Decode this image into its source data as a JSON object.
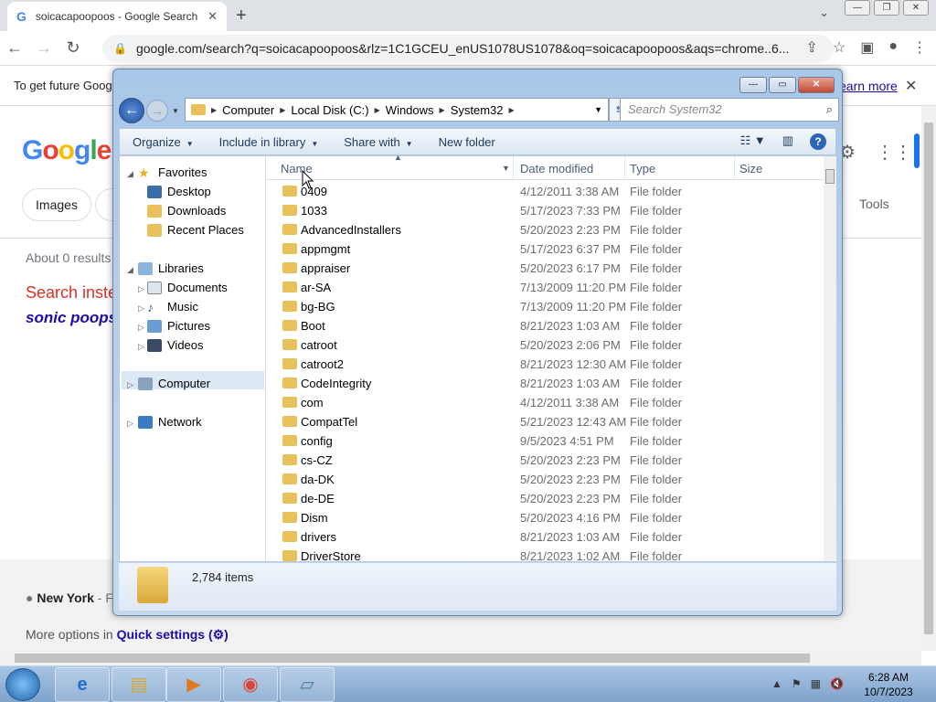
{
  "browser": {
    "tab_title": "soicacapoopoos - Google Search",
    "tab_close": "✕",
    "new_tab": "+",
    "url": "google.com/search?q=soicacapoopoos&rlz=1C1GCEU_enUS1078US1078&oq=soicacapoopoos&aqs=chrome..6...",
    "infobar_text": "To get future Goog",
    "infobar_link": "earn more",
    "infobar_close": "✕"
  },
  "google": {
    "logo": "Google",
    "pill_images": "Images",
    "tools": "Tools",
    "results_count": "About 0 results",
    "search_instead": "Search inste",
    "suggestion": "sonic poops",
    "location_city": "New York",
    "location_rest": " - Fi",
    "more_options_prefix": "More options in ",
    "more_options_link": "Quick settings (⚙)"
  },
  "explorer": {
    "breadcrumb": [
      "Computer",
      "Local Disk (C:)",
      "Windows",
      "System32"
    ],
    "search_placeholder": "Search System32",
    "commands": [
      "Organize",
      "Include in library",
      "Share with",
      "New folder"
    ],
    "nav": {
      "favorites": "Favorites",
      "desktop": "Desktop",
      "downloads": "Downloads",
      "recent": "Recent Places",
      "libraries": "Libraries",
      "documents": "Documents",
      "music": "Music",
      "pictures": "Pictures",
      "videos": "Videos",
      "computer": "Computer",
      "network": "Network"
    },
    "columns": {
      "name": "Name",
      "date": "Date modified",
      "type": "Type",
      "size": "Size"
    },
    "files": [
      {
        "name": "0409",
        "date": "4/12/2011 3:38 AM",
        "type": "File folder"
      },
      {
        "name": "1033",
        "date": "5/17/2023 7:33 PM",
        "type": "File folder"
      },
      {
        "name": "AdvancedInstallers",
        "date": "5/20/2023 2:23 PM",
        "type": "File folder"
      },
      {
        "name": "appmgmt",
        "date": "5/17/2023 6:37 PM",
        "type": "File folder"
      },
      {
        "name": "appraiser",
        "date": "5/20/2023 6:17 PM",
        "type": "File folder"
      },
      {
        "name": "ar-SA",
        "date": "7/13/2009 11:20 PM",
        "type": "File folder"
      },
      {
        "name": "bg-BG",
        "date": "7/13/2009 11:20 PM",
        "type": "File folder"
      },
      {
        "name": "Boot",
        "date": "8/21/2023 1:03 AM",
        "type": "File folder"
      },
      {
        "name": "catroot",
        "date": "5/20/2023 2:06 PM",
        "type": "File folder"
      },
      {
        "name": "catroot2",
        "date": "8/21/2023 12:30 AM",
        "type": "File folder"
      },
      {
        "name": "CodeIntegrity",
        "date": "8/21/2023 1:03 AM",
        "type": "File folder"
      },
      {
        "name": "com",
        "date": "4/12/2011 3:38 AM",
        "type": "File folder"
      },
      {
        "name": "CompatTel",
        "date": "5/21/2023 12:43 AM",
        "type": "File folder"
      },
      {
        "name": "config",
        "date": "9/5/2023 4:51 PM",
        "type": "File folder"
      },
      {
        "name": "cs-CZ",
        "date": "5/20/2023 2:23 PM",
        "type": "File folder"
      },
      {
        "name": "da-DK",
        "date": "5/20/2023 2:23 PM",
        "type": "File folder"
      },
      {
        "name": "de-DE",
        "date": "5/20/2023 2:23 PM",
        "type": "File folder"
      },
      {
        "name": "Dism",
        "date": "5/20/2023 4:16 PM",
        "type": "File folder"
      },
      {
        "name": "drivers",
        "date": "8/21/2023 1:03 AM",
        "type": "File folder"
      },
      {
        "name": "DriverStore",
        "date": "8/21/2023 1:02 AM",
        "type": "File folder"
      }
    ],
    "item_count": "2,784 items"
  },
  "taskbar": {
    "time": "6:28 AM",
    "date": "10/7/2023"
  }
}
